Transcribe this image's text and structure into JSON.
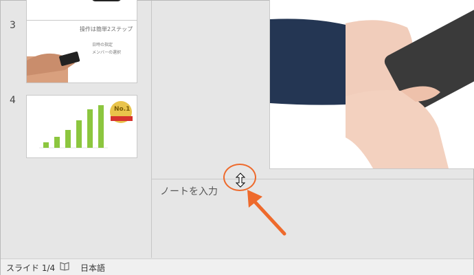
{
  "thumbnails": [
    {
      "number": "3",
      "title": "操作は簡単2ステップ",
      "bullets": [
        "日時の指定",
        "メンバーの選択"
      ]
    },
    {
      "number": "4",
      "badge": "No.1"
    }
  ],
  "notes": {
    "placeholder": "ノートを入力"
  },
  "status": {
    "slide": "スライド 1/4",
    "language": "日本語"
  },
  "accent": {
    "highlight": "#ee6a2c",
    "bars": "#8cc63f"
  }
}
